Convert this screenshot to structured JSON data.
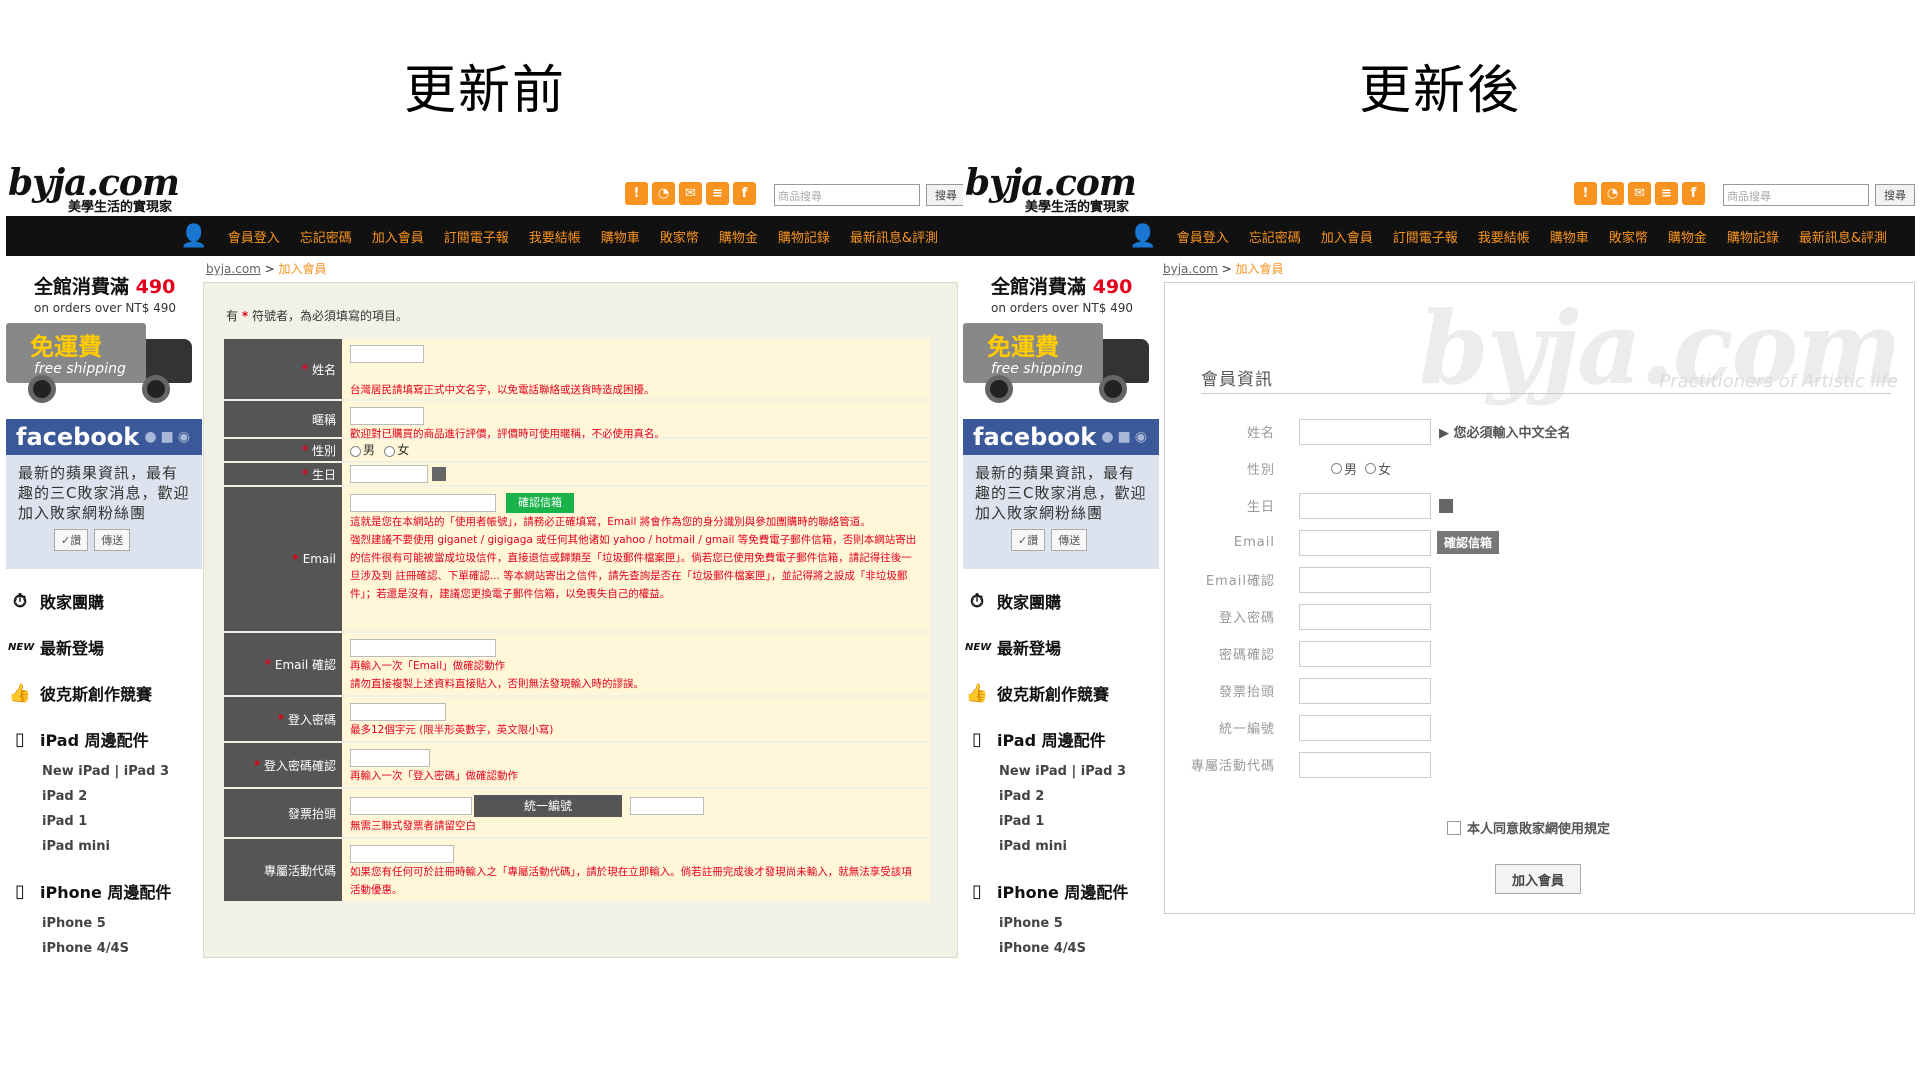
{
  "titles": {
    "left": "更新前",
    "right": "更新後"
  },
  "brand": {
    "logo": "byja.com",
    "tagline": "美學生活的實現家",
    "accent": "#f7931e",
    "fb_blue": "#3b5998"
  },
  "header": {
    "icons": [
      "info-icon",
      "rss-icon",
      "mail-icon",
      "list-icon",
      "facebook-icon"
    ],
    "search_placeholder": "商品搜尋",
    "search_button": "搜尋",
    "nav": [
      "會員登入",
      "忘記密碼",
      "加入會員",
      "訂閱電子報",
      "我要結帳",
      "購物車",
      "敗家幣",
      "購物金",
      "購物記錄",
      "最新訊息&評測"
    ]
  },
  "sidebar": {
    "promo_prefix": "全館消費滿",
    "promo_amount": "490",
    "promo_sub": "on orders over NT$ 490",
    "truck_label": "免運費",
    "truck_sub": "free shipping",
    "fb_title": "facebook",
    "fb_text": "最新的蘋果資訊，最有趣的三C敗家消息，歡迎加入敗家網粉絲團",
    "fb_like": "✓讚",
    "fb_send": "傳送",
    "menu": [
      {
        "label": "敗家團購"
      },
      {
        "label": "最新登場",
        "tag": "NEW"
      },
      {
        "label": "彼克斯創作競賽"
      },
      {
        "label": "iPad 周邊配件",
        "subs": [
          "New iPad | iPad 3",
          "iPad 2",
          "iPad 1",
          "iPad mini"
        ]
      },
      {
        "label": "iPhone 周邊配件",
        "subs": [
          "iPhone 5",
          "iPhone 4/4S"
        ]
      }
    ]
  },
  "breadcrumb": {
    "home": "byja.com",
    "sep": " > ",
    "current": "加入會員"
  },
  "old_form": {
    "note_prefix": "有",
    "note_star": "*",
    "note_suffix": "符號者，為必須填寫的項目。",
    "rows": [
      {
        "label": "姓名",
        "required": true,
        "hint": "台灣居民請填寫正式中文名字，以免電話聯絡或送貨時造成困擾。"
      },
      {
        "label": "暱稱",
        "required": false,
        "hint": "歡迎對已購買的商品進行評價，評價時可使用暱稱，不必使用真名。"
      },
      {
        "label": "性別",
        "required": true,
        "male": "男",
        "female": "女"
      },
      {
        "label": "生日",
        "required": true
      },
      {
        "label": "Email",
        "required": true,
        "button": "確認信箱",
        "hint": "這就是您在本網站的「使用者帳號」，請務必正確填寫，Email 將會作為您的身分識別與參加團購時的聯絡管道。",
        "hint2": "強烈建議不要使用 giganet / gigigaga 或任何其他诸如 yahoo / hotmail / gmail 等免費電子郵件信箱，否則本網站寄出的信件很有可能被當成垃圾信件，直接退信或歸類至「垃圾郵件檔案匣」。倘若您已使用免費電子郵件信箱，請記得往後一旦涉及到 註冊確認、下單確認... 等本網站寄出之信件，請先查詢是否在「垃圾郵件檔案匣」，並記得將之設成「非垃圾郵件」；若還是沒有，建議您更換電子郵件信箱，以免喪失自己的權益。"
      },
      {
        "label": "Email 確認",
        "required": true,
        "hint": "再輸入一次「Email」做確認動作",
        "hint2": "請勿直接複製上述資料直接貼入，否則無法發現輸入時的謬誤。"
      },
      {
        "label": "登入密碼",
        "required": true,
        "hint": "最多12個字元 (限半形英數字，英文限小寫)"
      },
      {
        "label": "登入密碼確認",
        "required": true,
        "hint": "再輸入一次「登入密碼」做確認動作"
      },
      {
        "label": "發票抬頭",
        "required": false,
        "tax_label": "統一編號",
        "hint": "無需三聯式發票者請留空白"
      },
      {
        "label": "專屬活動代碼",
        "required": false,
        "hint": "如果您有任何可於註冊時輸入之「專屬活動代碼」，請於現在立即輸入。倘若註冊完成後才發現尚未輸入，就無法享受該項活動優惠。"
      }
    ]
  },
  "new_form": {
    "watermark": "byja.com",
    "watermark_sub": "Practitioners of Artistic life",
    "title": "會員資訊",
    "rows": [
      {
        "label": "姓名",
        "hint": "▶ 您必須輸入中文全名"
      },
      {
        "label": "性別",
        "male": "男",
        "female": "女"
      },
      {
        "label": "生日"
      },
      {
        "label": "Email",
        "button": "確認信箱"
      },
      {
        "label": "Email確認"
      },
      {
        "label": "登入密碼"
      },
      {
        "label": "密碼確認"
      },
      {
        "label": "發票抬頭"
      },
      {
        "label": "統一編號"
      },
      {
        "label": "專屬活動代碼"
      }
    ],
    "agree": "本人同意敗家網使用規定",
    "submit": "加入會員"
  }
}
